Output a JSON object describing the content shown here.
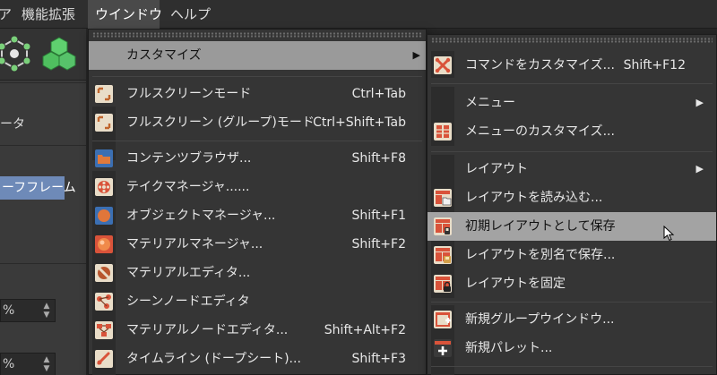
{
  "menubar": {
    "items": [
      {
        "label": "ア"
      },
      {
        "label": "機能拡張"
      },
      {
        "label": "ウインドウ"
      },
      {
        "label": "ヘルプ"
      }
    ]
  },
  "left_panel": {
    "label_data": "ータ",
    "selected_item": "ーフフレーム",
    "field1_value": "%",
    "field2_value": "%"
  },
  "window_menu": {
    "items": [
      {
        "label": "カスタマイズ",
        "shortcut": "",
        "submenu": true,
        "icon": "none"
      },
      {
        "label": "フルスクリーンモード",
        "shortcut": "Ctrl+Tab",
        "icon": "fullscreen-icon"
      },
      {
        "label": "フルスクリーン (グループ)モード",
        "shortcut": "Ctrl+Shift+Tab",
        "icon": "fullscreen-group-icon"
      },
      {
        "label": "コンテンツブラウザ...",
        "shortcut": "Shift+F8",
        "icon": "content-browser-icon"
      },
      {
        "label": "テイクマネージャ......",
        "shortcut": "",
        "icon": "take-manager-icon"
      },
      {
        "label": "オブジェクトマネージャ...",
        "shortcut": "Shift+F1",
        "icon": "object-manager-icon"
      },
      {
        "label": "マテリアルマネージャ...",
        "shortcut": "Shift+F2",
        "icon": "material-manager-icon"
      },
      {
        "label": "マテリアルエディタ...",
        "shortcut": "",
        "icon": "material-editor-icon"
      },
      {
        "label": "シーンノードエディタ",
        "shortcut": "",
        "icon": "scene-node-editor-icon"
      },
      {
        "label": "マテリアルノードエディタ...",
        "shortcut": "Shift+Alt+F2",
        "icon": "material-node-editor-icon"
      },
      {
        "label": "タイムライン (ドープシート)...",
        "shortcut": "Shift+F3",
        "icon": "timeline-icon"
      }
    ]
  },
  "customize_submenu": {
    "items": [
      {
        "label": "コマンドをカスタマイズ...",
        "shortcut": "Shift+F12",
        "icon": "customize-commands-icon"
      },
      {
        "label": "メニュー",
        "shortcut": "",
        "submenu": true,
        "icon": "none"
      },
      {
        "label": "メニューのカスタマイズ...",
        "shortcut": "",
        "icon": "customize-menus-icon"
      },
      {
        "label": "レイアウト",
        "shortcut": "",
        "submenu": true,
        "icon": "none"
      },
      {
        "label": "レイアウトを読み込む...",
        "shortcut": "",
        "icon": "load-layout-icon"
      },
      {
        "label": "初期レイアウトとして保存",
        "shortcut": "",
        "icon": "save-startup-layout-icon",
        "highlighted": true
      },
      {
        "label": "レイアウトを別名で保存...",
        "shortcut": "",
        "icon": "save-layout-as-icon"
      },
      {
        "label": "レイアウトを固定",
        "shortcut": "",
        "icon": "lock-layout-icon"
      },
      {
        "label": "新規グループウインドウ...",
        "shortcut": "",
        "icon": "new-group-window-icon"
      },
      {
        "label": "新規パレット...",
        "shortcut": "",
        "icon": "new-palette-icon"
      }
    ]
  },
  "colors": {
    "menu_bg": "#353535",
    "highlight": "#9a9a9a",
    "icon_orange": "#e0763a",
    "icon_red": "#d9533a",
    "selection_blue": "#6e8ab8",
    "cube_green": "#57c26a"
  },
  "submenu_arrow_glyph": "▶"
}
